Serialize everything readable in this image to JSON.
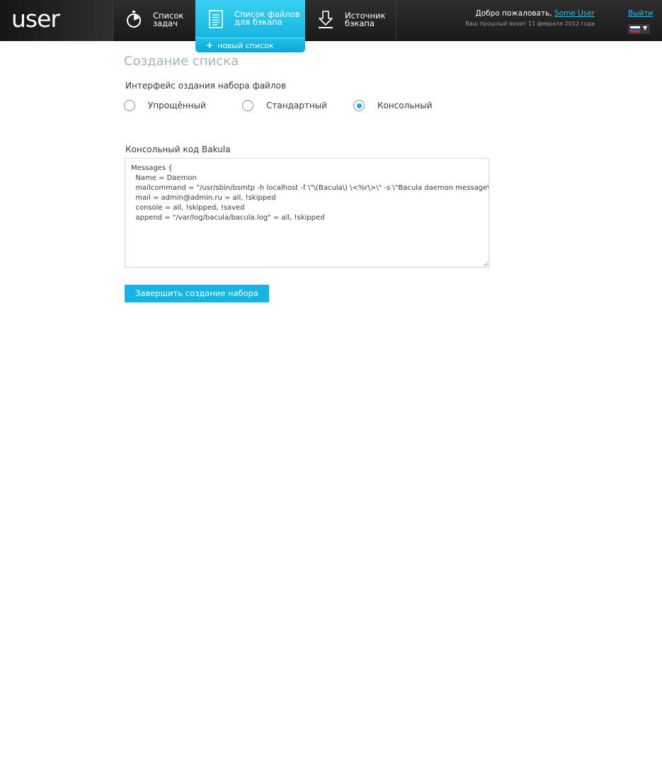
{
  "header": {
    "logo": "user",
    "nav": [
      {
        "line1": "Список",
        "line2": "задач"
      },
      {
        "line1": "Список файлов",
        "line2": "для бэкапа"
      },
      {
        "line1": "Источник",
        "line2": "бэкапа"
      }
    ],
    "sub_tab": {
      "plus": "+",
      "label": "новый список"
    },
    "welcome_text": "Добро пожаловать, ",
    "user_name": "Some User",
    "last_visit": "Ваш прошлый визит 11 февраля 2012 года",
    "logout": "Выйти",
    "language_arrow": "▼"
  },
  "main": {
    "title": "Создание списка",
    "interface_label": "Интерфейс оздания набора файлов",
    "options": [
      {
        "label": "Упрощённый",
        "checked": false
      },
      {
        "label": "Стандартный",
        "checked": false
      },
      {
        "label": "Консольный",
        "checked": true
      }
    ],
    "code_label": "Консольный код Bakula",
    "code": "Messages {\n  Name = Daemon\n  mailcommand = \"/usr/sbin/bsmtp -h localhost -f \\\"\\(Bacula\\) \\<%r\\>\\\" -s \\\"Bacula daemon message\\\" %r\"\n  mail = admin@admin.ru = all, !skipped\n  console = all, !skipped, !saved\n  append = \"/var/log/bacula/bacula.log\" = all, !skipped",
    "submit": "Завершить создание набора"
  },
  "colors": {
    "accent": "#14b5e2",
    "header_bg": "#222222",
    "title": "#9fb6c0"
  }
}
